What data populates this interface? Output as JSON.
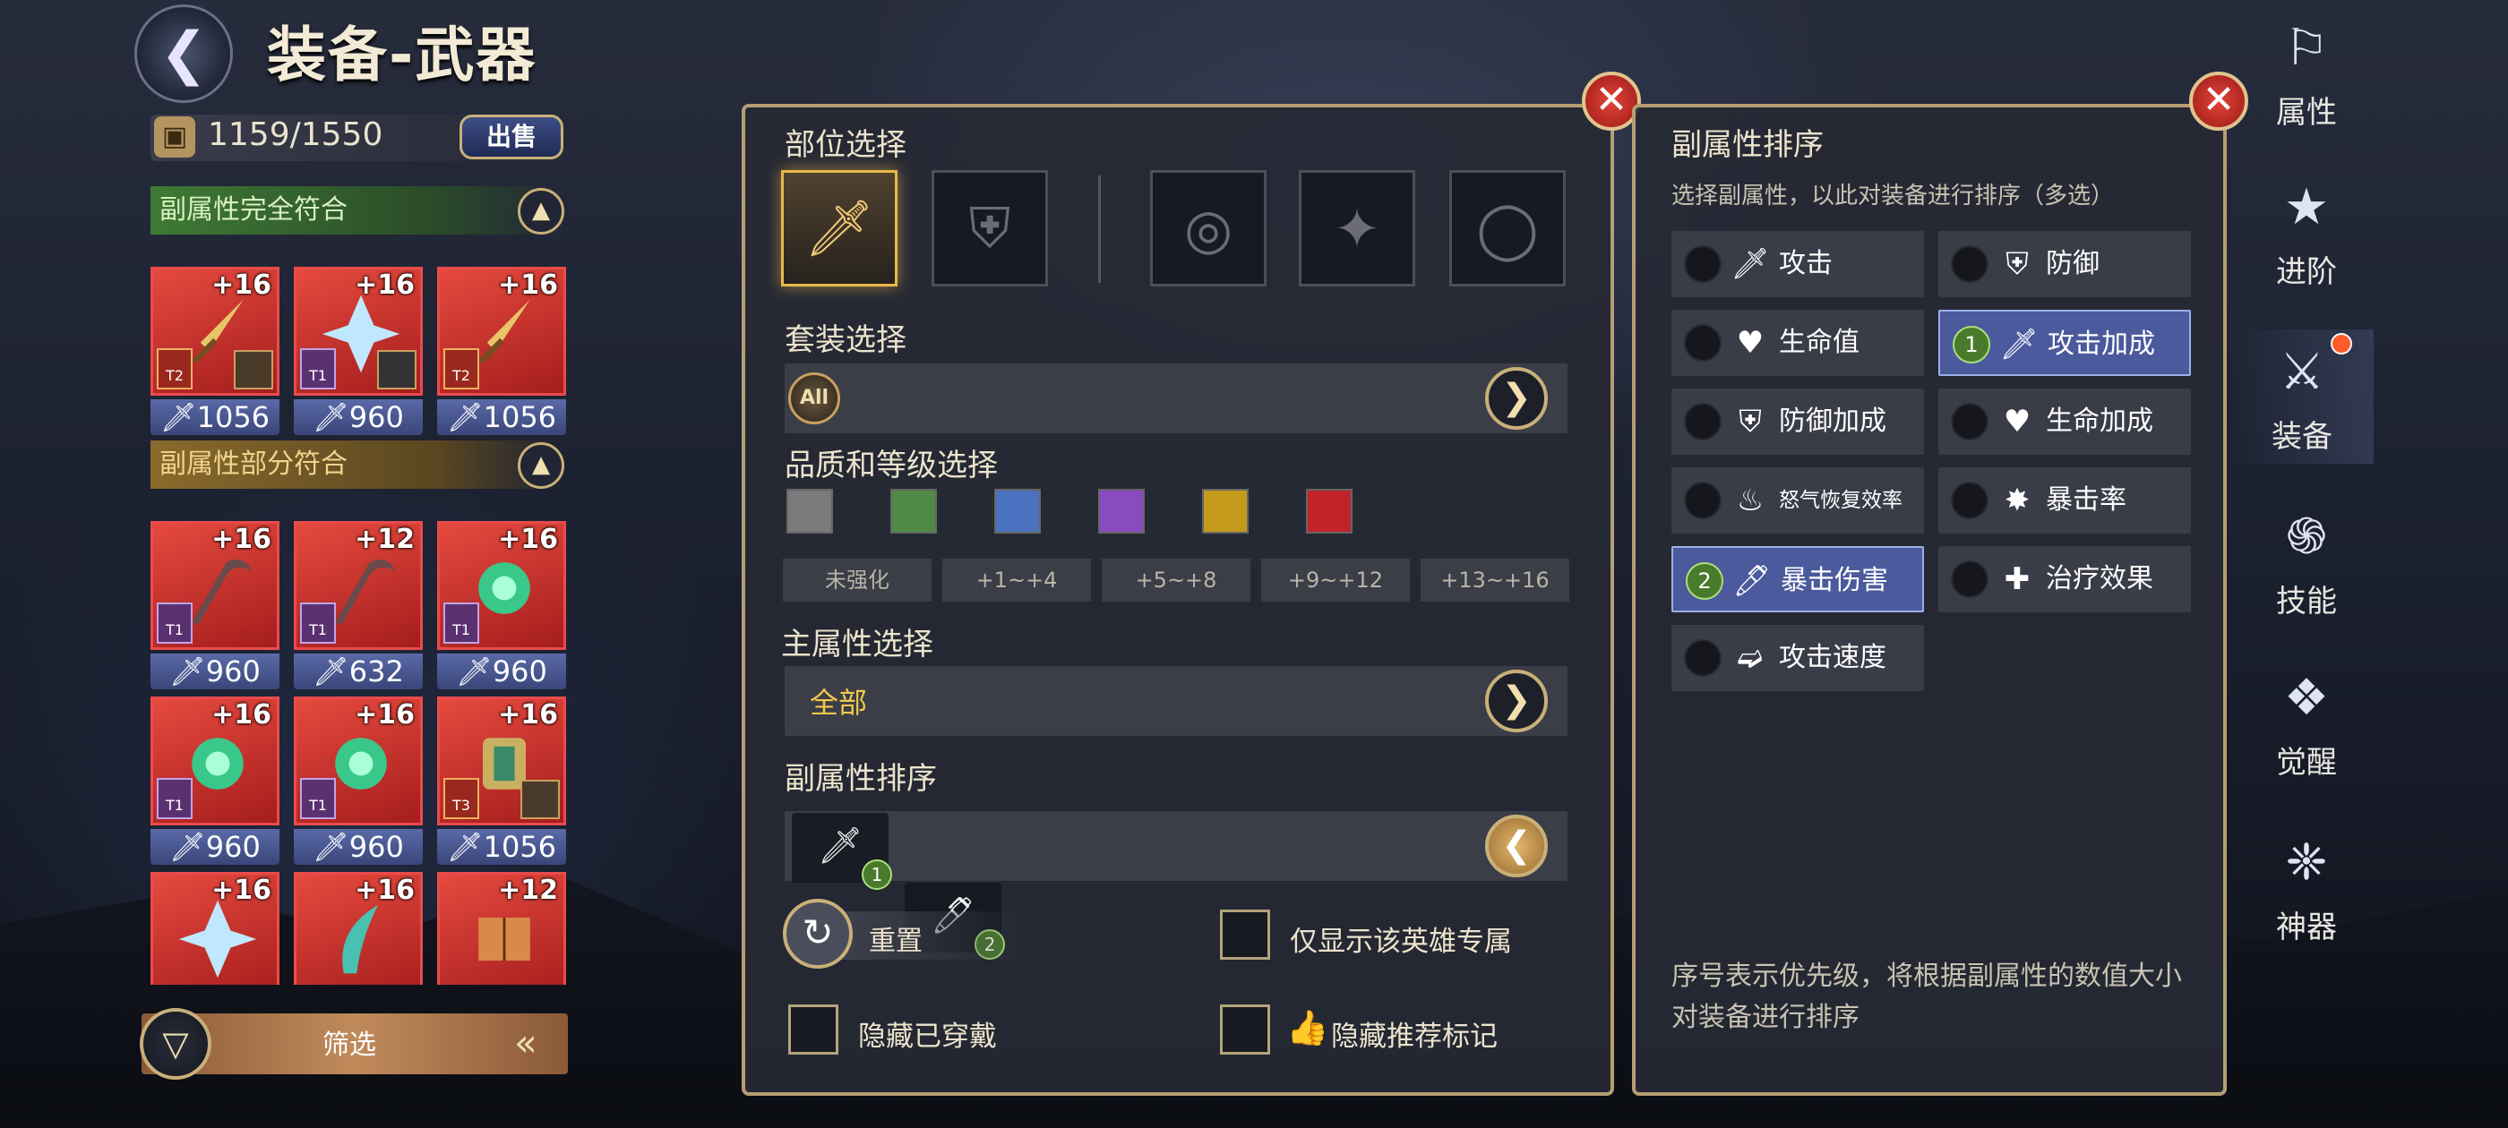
{
  "header": {
    "title": "装备-武器",
    "capacity": "1159/1550",
    "sell_label": "出售"
  },
  "sections": {
    "full_match": "副属性完全符合",
    "partial_match": "副属性部分符合"
  },
  "items_full": [
    {
      "level": "+16",
      "stat": "1056",
      "tier": "T2",
      "tier_color": "red"
    },
    {
      "level": "+16",
      "stat": "960",
      "tier": "T1",
      "tier_color": "purple"
    },
    {
      "level": "+16",
      "stat": "1056",
      "tier": "T2",
      "tier_color": "red"
    }
  ],
  "items_partial": [
    {
      "level": "+16",
      "stat": "960",
      "tier": "T1"
    },
    {
      "level": "+12",
      "stat": "632",
      "tier": "T1"
    },
    {
      "level": "+16",
      "stat": "960",
      "tier": "T1"
    },
    {
      "level": "+16",
      "stat": "960",
      "tier": "T1"
    },
    {
      "level": "+16",
      "stat": "960",
      "tier": "T1"
    },
    {
      "level": "+16",
      "stat": "1056",
      "tier": "T3"
    },
    {
      "level": "+16",
      "stat": "",
      "tier": ""
    },
    {
      "level": "+16",
      "stat": "",
      "tier": ""
    },
    {
      "level": "+12",
      "stat": "",
      "tier": ""
    }
  ],
  "filter_label": "筛选",
  "filter_panel": {
    "part_title": "部位选择",
    "set_title": "套装选择",
    "set_all": "All",
    "quality_title": "品质和等级选择",
    "quality_colors": [
      "#7a7a7a",
      "#4f8a46",
      "#4a72c0",
      "#8a4ac0",
      "#c49a1a",
      "#c0242a"
    ],
    "ranges": [
      "未强化",
      "+1~+4",
      "+5~+8",
      "+9~+12",
      "+13~+16"
    ],
    "main_title": "主属性选择",
    "main_value": "全部",
    "sub_title": "副属性排序",
    "sort_nums": [
      "1",
      "2"
    ],
    "reset": "重置",
    "only_hero": "仅显示该英雄专属",
    "hide_worn": "隐藏已穿戴",
    "hide_rec": "隐藏推荐标记"
  },
  "sort_panel": {
    "title": "副属性排序",
    "desc": "选择副属性，以此对装备进行排序（多选）",
    "attrs": [
      {
        "label": "攻击",
        "num": ""
      },
      {
        "label": "防御",
        "num": ""
      },
      {
        "label": "生命值",
        "num": ""
      },
      {
        "label": "攻击加成",
        "num": "1"
      },
      {
        "label": "防御加成",
        "num": ""
      },
      {
        "label": "生命加成",
        "num": ""
      },
      {
        "label": "怒气恢复效率",
        "num": ""
      },
      {
        "label": "暴击率",
        "num": ""
      },
      {
        "label": "暴击伤害",
        "num": "2"
      },
      {
        "label": "治疗效果",
        "num": ""
      },
      {
        "label": "攻击速度",
        "num": ""
      }
    ],
    "footer": "序号表示优先级，将根据副属性的数值大小对装备进行排序"
  },
  "nav": [
    {
      "label": "属性",
      "icon": "attribute-icon"
    },
    {
      "label": "进阶",
      "icon": "advance-icon"
    },
    {
      "label": "装备",
      "icon": "equipment-icon"
    },
    {
      "label": "技能",
      "icon": "skill-icon"
    },
    {
      "label": "觉醒",
      "icon": "awaken-icon"
    },
    {
      "label": "神器",
      "icon": "artifact-icon"
    }
  ]
}
